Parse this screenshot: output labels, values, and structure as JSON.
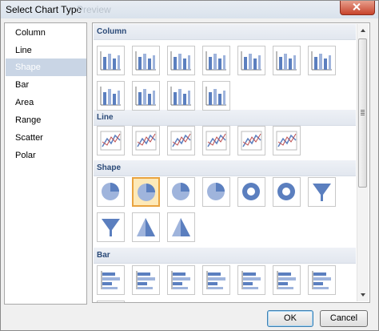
{
  "window": {
    "title": "Select Chart Type",
    "ghost_title": "Preview"
  },
  "chart_types": [
    {
      "label": "Column",
      "selected": false
    },
    {
      "label": "Line",
      "selected": false
    },
    {
      "label": "Shape",
      "selected": true
    },
    {
      "label": "Bar",
      "selected": false
    },
    {
      "label": "Area",
      "selected": false
    },
    {
      "label": "Range",
      "selected": false
    },
    {
      "label": "Scatter",
      "selected": false
    },
    {
      "label": "Polar",
      "selected": false
    }
  ],
  "groups": [
    {
      "name": "Column",
      "tile_icons": [
        "clustered-column-icon",
        "stacked-column-icon",
        "100-stacked-column-icon",
        "3d-clustered-column-icon",
        "3d-stacked-column-icon",
        "3d-100-stacked-column-icon",
        "3d-column-icon",
        "cylinder-column-icon",
        "cylinder-stacked-column-icon",
        "cylinder-100-stacked-column-icon",
        "cylinder-3d-column-icon"
      ]
    },
    {
      "name": "Line",
      "tile_icons": [
        "line-chart-icon",
        "smooth-line-chart-icon",
        "stepped-line-chart-icon",
        "3d-line-chart-icon",
        "line-markers-chart-icon",
        "smooth-line-markers-chart-icon"
      ]
    },
    {
      "name": "Shape",
      "tile_icons": [
        "pie-chart-icon",
        "exploded-pie-chart-icon",
        "3d-pie-chart-icon",
        "3d-exploded-pie-chart-icon",
        "doughnut-chart-icon",
        "exploded-doughnut-chart-icon",
        "funnel-chart-icon",
        "3d-funnel-chart-icon",
        "pyramid-chart-icon",
        "3d-pyramid-chart-icon"
      ],
      "selected_tile": 1
    },
    {
      "name": "Bar",
      "tile_icons": [
        "clustered-bar-icon",
        "stacked-bar-icon",
        "100-stacked-bar-icon",
        "3d-clustered-bar-icon",
        "3d-stacked-bar-icon",
        "3d-100-stacked-bar-icon",
        "3d-bar-icon",
        "cylinder-bar-icon"
      ]
    }
  ],
  "buttons": {
    "ok": "OK",
    "cancel": "Cancel"
  },
  "colors": {
    "selection_bg": "#c9d5e5",
    "header_text": "#2b4a78",
    "tile_selected_border": "#e9a340",
    "icon_blue": "#5b7fbf"
  }
}
